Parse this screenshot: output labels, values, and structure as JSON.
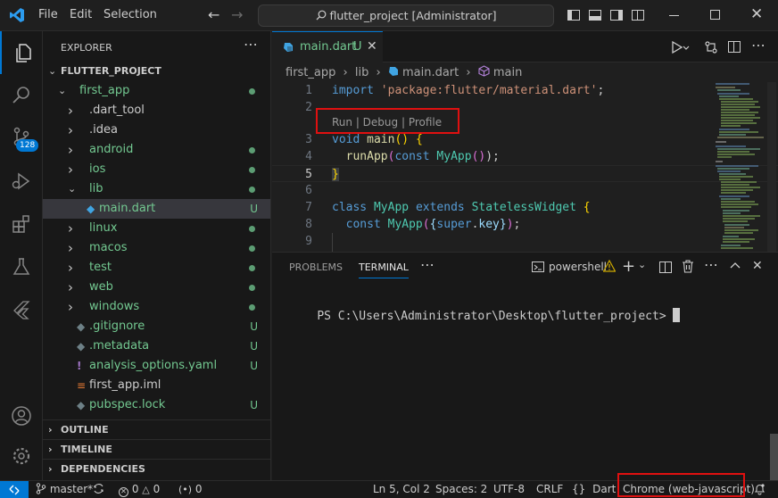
{
  "titlebar": {
    "menus": [
      "File",
      "Edit",
      "Selection"
    ],
    "command_center": "flutter_project [Administrator]"
  },
  "activity": {
    "scm_badge": "128"
  },
  "explorer": {
    "title": "EXPLORER",
    "project": "FLUTTER_PROJECT",
    "items": [
      {
        "label": "first_app",
        "kind": "folder-open",
        "status": "dot",
        "color": "#73c991"
      },
      {
        "label": ".dart_tool",
        "kind": "folder",
        "status": "",
        "color": "#cccccc"
      },
      {
        "label": ".idea",
        "kind": "folder",
        "status": "",
        "color": "#cccccc"
      },
      {
        "label": "android",
        "kind": "folder",
        "status": "dot",
        "color": "#73c991"
      },
      {
        "label": "ios",
        "kind": "folder",
        "status": "dot",
        "color": "#73c991"
      },
      {
        "label": "lib",
        "kind": "folder-open",
        "status": "dot",
        "color": "#73c991"
      },
      {
        "label": "main.dart",
        "kind": "dart",
        "status": "U",
        "color": "#73c991"
      },
      {
        "label": "linux",
        "kind": "folder",
        "status": "dot",
        "color": "#73c991"
      },
      {
        "label": "macos",
        "kind": "folder",
        "status": "dot",
        "color": "#73c991"
      },
      {
        "label": "test",
        "kind": "folder",
        "status": "dot",
        "color": "#73c991"
      },
      {
        "label": "web",
        "kind": "folder",
        "status": "dot",
        "color": "#73c991"
      },
      {
        "label": "windows",
        "kind": "folder",
        "status": "dot",
        "color": "#73c991"
      },
      {
        "label": ".gitignore",
        "kind": "dart",
        "status": "U",
        "color": "#73c991"
      },
      {
        "label": ".metadata",
        "kind": "dart",
        "status": "U",
        "color": "#73c991"
      },
      {
        "label": "analysis_options.yaml",
        "kind": "yaml",
        "status": "U",
        "color": "#73c991"
      },
      {
        "label": "first_app.iml",
        "kind": "iml",
        "status": "",
        "color": "#cccccc"
      },
      {
        "label": "pubspec.lock",
        "kind": "dart",
        "status": "U",
        "color": "#73c991"
      }
    ],
    "sections": [
      "OUTLINE",
      "TIMELINE",
      "DEPENDENCIES"
    ]
  },
  "editor": {
    "tab": {
      "name": "main.dart",
      "status": "U"
    },
    "breadcrumb": [
      "first_app",
      "lib",
      "main.dart",
      "main"
    ],
    "codelens": "Run | Debug | Profile",
    "line_numbers": [
      "1",
      "2",
      "3",
      "4",
      "5",
      "6",
      "7",
      "8",
      "9"
    ]
  },
  "panel": {
    "tabs": [
      "PROBLEMS",
      "TERMINAL"
    ],
    "shell": "powershell",
    "prompt": "PS C:\\Users\\Administrator\\Desktop\\flutter_project> "
  },
  "status": {
    "branch": "master*",
    "errors": "0",
    "warnings": "0",
    "ports": "0",
    "position": "Ln 5, Col 2",
    "spaces": "Spaces: 2",
    "encoding": "UTF-8",
    "eol": "CRLF",
    "language": "Dart",
    "device": "Chrome (web-javascript)"
  }
}
